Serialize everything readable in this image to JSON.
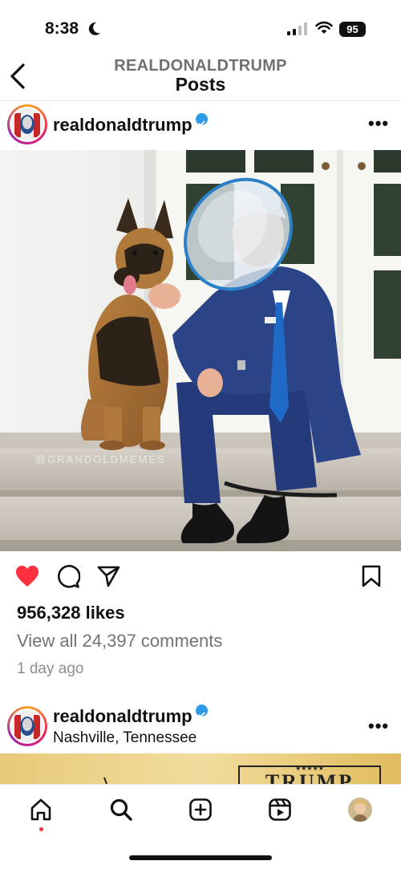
{
  "status": {
    "time": "8:38",
    "battery": "95"
  },
  "header": {
    "account_title": "REALDONALDTRUMP",
    "page_title": "Posts"
  },
  "posts": [
    {
      "username": "realdonaldtrump",
      "more_label": "•••",
      "image_watermark": "@GRANDOLDMEMES",
      "likes": "956,328 likes",
      "comments_link": "View all 24,397 comments",
      "time_ago": "1 day ago",
      "liked": true
    },
    {
      "username": "realdonaldtrump",
      "location": "Nashville, Tennessee",
      "more_label": "•••",
      "banner_stars": "★★★★★",
      "banner_text": "TRUMP"
    }
  ],
  "icons": {
    "status": [
      "moon-icon",
      "signal-icon",
      "wifi-icon",
      "battery-icon"
    ],
    "nav": [
      "back-arrow-icon"
    ],
    "actions": [
      "heart-icon",
      "comment-icon",
      "share-icon",
      "bookmark-icon"
    ],
    "tabs": [
      "home-icon",
      "search-icon",
      "create-icon",
      "reels-icon",
      "profile-avatar"
    ]
  },
  "colors": {
    "like_red": "#ff3040",
    "verified_blue": "#2f9be8",
    "secondary_text": "#737373"
  }
}
